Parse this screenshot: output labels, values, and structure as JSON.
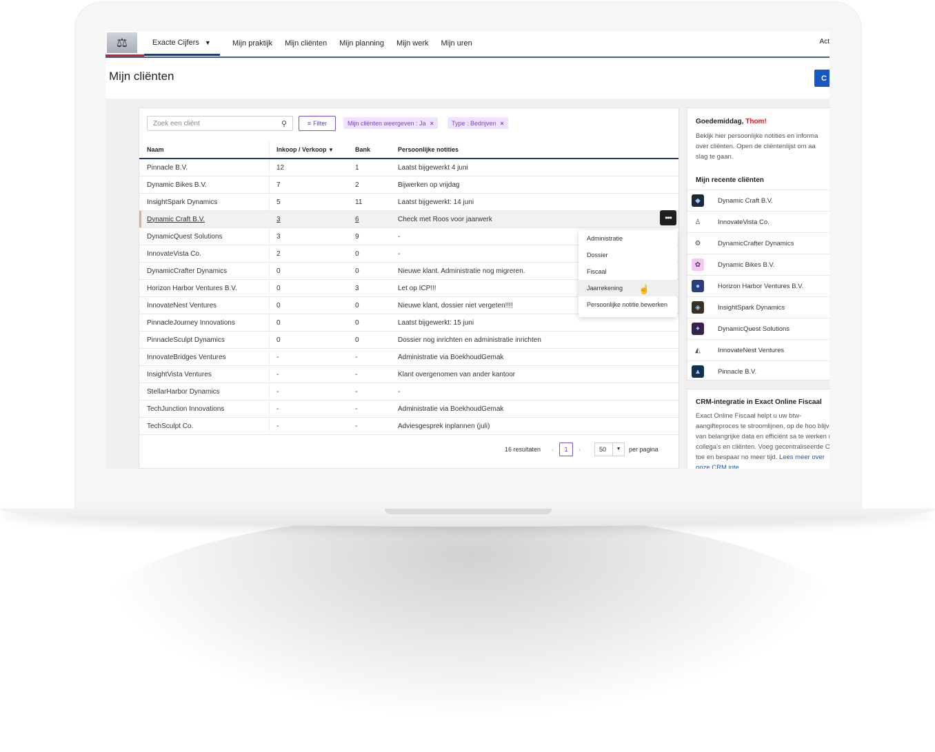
{
  "nav": {
    "company": "Exacte Cijfers",
    "menu": [
      "Mijn praktijk",
      "Mijn cliënten",
      "Mijn planning",
      "Mijn werk",
      "Mijn uren"
    ],
    "right_text": "Act"
  },
  "page": {
    "title": "Mijn cliënten",
    "top_button": "C"
  },
  "toolbar": {
    "search_placeholder": "Zoek een cliënt",
    "filter_label": "Filter",
    "chips": [
      "Mijn cliënten weergeven : Ja",
      "Type : Bedrijven"
    ]
  },
  "table": {
    "headers": [
      "Naam",
      "Inkoop / Verkoop",
      "Bank",
      "Persoonlijke notities"
    ],
    "sort_indicator": "▼",
    "rows": [
      [
        "Pinnacle B.V.",
        "12",
        "1",
        "Laatst bijgewerkt 4 juni"
      ],
      [
        "Dynamic Bikes B.V.",
        "7",
        "2",
        "Bijwerken op vrijdag"
      ],
      [
        "InsightSpark Dynamics",
        "5",
        "11",
        "Laatst bijgewerkt: 14 juni"
      ],
      [
        "Dynamic Craft B.V.",
        "3",
        "6",
        "Check met Roos voor jaarwerk"
      ],
      [
        "DynamicQuest Solutions",
        "3",
        "9",
        "-"
      ],
      [
        "InnovateVista Co.",
        "2",
        "0",
        "-"
      ],
      [
        "DynamicCrafter Dynamics",
        "0",
        "0",
        "Nieuwe klant. Administratie nog migreren."
      ],
      [
        "Horizon Harbor Ventures B.V.",
        "0",
        "3",
        "Let op ICP!!!"
      ],
      [
        "InnovateNest Ventures",
        "0",
        "0",
        "Nieuwe klant, dossier niet vergeten!!!!"
      ],
      [
        "PinnacleJourney Innovations",
        "0",
        "0",
        "Laatst bijgewerkt: 15 juni"
      ],
      [
        "PinnacleSculpt Dynamics",
        "0",
        "0",
        "Dossier nog inrichten en administratie inrichten"
      ],
      [
        "InnovateBridges Ventures",
        "-",
        "-",
        "Administratie via BoekhoudGemak"
      ],
      [
        "InsightVista Ventures",
        "-",
        "-",
        "Klant overgenomen van ander kantoor"
      ],
      [
        "StellarHarbor Dynamics",
        "-",
        "-",
        "-"
      ],
      [
        "TechJunction Innovations",
        "-",
        "-",
        "Administratie via BoekhoudGemak"
      ],
      [
        "TechSculpt Co.",
        "-",
        "-",
        "Adviesgesprek inplannen (juli)"
      ]
    ],
    "highlighted_row": 3
  },
  "context_menu": {
    "more_label": "•••",
    "items": [
      "Administratie",
      "Dossier",
      "Fiscaal",
      "Jaarrekening",
      "Persoonlijke notitie bewerken"
    ],
    "hovered_index": 3
  },
  "pager": {
    "results": "16 resultaten",
    "prev": "‹",
    "page": "1",
    "next": "›",
    "page_size": "50",
    "per_page": "per pagina"
  },
  "sidebar": {
    "greeting": "Goedemiddag, ",
    "user": "Thom!",
    "intro": "Bekijk hier persoonlijke notities en informa\nover cliënten. Open de cliëntenlijst om aa\nslag te gaan.",
    "recent_title": "Mijn recente cliënten",
    "recent": [
      {
        "name": "Dynamic Craft B.V.",
        "color": "#1b2a3a"
      },
      {
        "name": "InnovateVista Co.",
        "color": "#ffffff"
      },
      {
        "name": "DynamicCrafter Dynamics",
        "color": "#ffffff"
      },
      {
        "name": "Dynamic Bikes B.V.",
        "color": "#f3c7ef"
      },
      {
        "name": "Horizon Harbor Ventures B.V.",
        "color": "#2a3f7a"
      },
      {
        "name": "InsightSpark Dynamics",
        "color": "#3a3020"
      },
      {
        "name": "DynamicQuest Solutions",
        "color": "#3a1f4a"
      },
      {
        "name": "InnovateNest Ventures",
        "color": "#ffffff"
      },
      {
        "name": "Pinnacle B.V.",
        "color": "#123050"
      }
    ],
    "crm_title": "CRM-integratie in Exact Online Fiscaal",
    "crm_text": "Exact Online Fiscaal helpt u uw btw-aangifteproces te stroomlijnen, op de hoo blijven van belangrijke data en efficiënt sa te werken met collega's en cliënten. Voeg gecentraliseerde CRM toe en bespaar no meer tijd. ",
    "crm_link": "Lees meer over onze CRM inte"
  },
  "colors": {
    "accent": "#1f3b75",
    "brand_red": "#d41f26",
    "purple": "#7b4fd6",
    "primary_blue": "#1656c5"
  }
}
